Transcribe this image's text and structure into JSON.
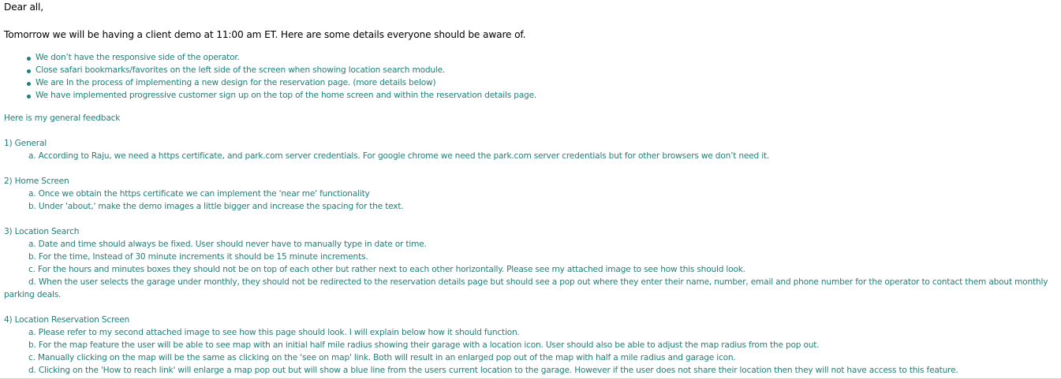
{
  "salutation": "Dear all,",
  "intro": "Tomorrow we will be having a client demo at 11:00 am ET. Here are some details everyone should be aware of.",
  "bullets": [
    "We don’t have the responsive side of the operator.",
    "Close safari bookmarks/favorites on the left side of the screen when showing location search module.",
    "We are In the process of implementing a new design for the reservation page. (more details below)",
    "We have implemented progressive customer sign up on the top of the home screen and within the reservation details page."
  ],
  "feedback_heading": "Here is my general feedback",
  "sections": [
    {
      "title": "1) General",
      "items": [
        "a. According to Raju, we need a https certificate, and park.com server credentials. For google chrome we need the park.com server credentials but for other browsers we don’t need it."
      ]
    },
    {
      "title": "2) Home Screen",
      "items": [
        "a. Once we obtain the https certificate we can implement the 'near me' functionality",
        "b. Under 'about,' make the demo images a little bigger and increase the spacing for the text."
      ]
    },
    {
      "title": "3) Location Search",
      "items": [
        "a. Date and time should always be fixed. User should never have to manually type in date or time.",
        "b. For the time, Instead of 30 minute increments it should be 15 minute increments.",
        "c. For the hours and minutes boxes they should not be on top of each other but rather next to each other horizontally. Please see my attached image to see how this should look.",
        "d. When the user selects the garage under monthly, they should not be redirected to the reservation details page but should see a pop out where they enter their name, number, email and phone number for the operator to contact them about monthly"
      ],
      "continuation": "parking deals."
    },
    {
      "title": "4) Location Reservation Screen",
      "items": [
        "a. Please refer to my second attached image to see how this page should look. I will explain below how it should function.",
        "b. For the map feature the user will be able to see map with an initial half  mile radius showing their garage with a location icon. User should also be able to adjust the map radius from the pop out.",
        "c. Manually clicking on the map will be the same as clicking on the 'see on map' link. Both will result in an enlarged pop out of the map with half a mile radius and garage icon.",
        "d. Clicking on the 'How to reach link' will enlarge a map pop out but will show a blue line from the users current location to the garage. However if the user does not share their location then they will not have access to this feature."
      ]
    }
  ]
}
